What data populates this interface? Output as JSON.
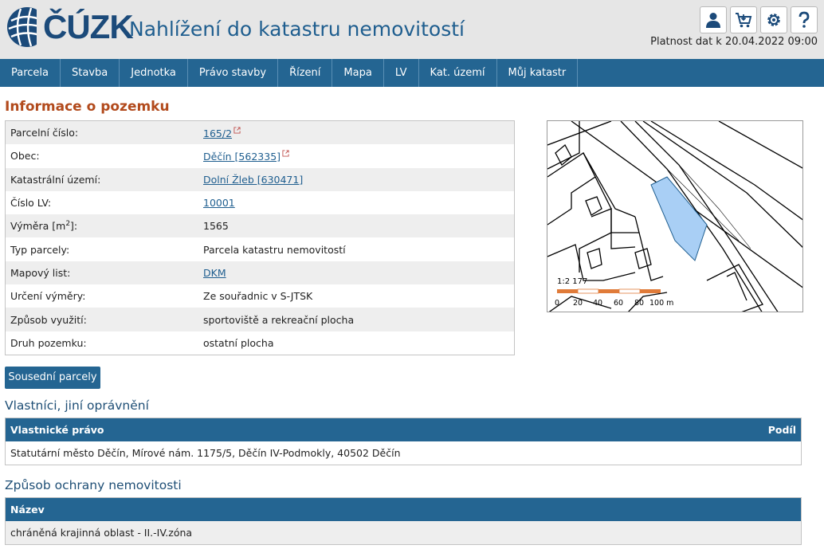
{
  "header": {
    "logo_text": "ČÚZK",
    "app_title": "Nahlížení do katastru nemovitostí",
    "validity": "Platnost dat k 20.04.2022 09:00",
    "icons": [
      "user-icon",
      "cart-icon",
      "settings-icon",
      "help-icon"
    ]
  },
  "nav": {
    "items": [
      "Parcela",
      "Stavba",
      "Jednotka",
      "Právo stavby",
      "Řízení",
      "Mapa",
      "LV",
      "Kat. území",
      "Můj katastr"
    ]
  },
  "info": {
    "title": "Informace o pozemku",
    "rows": [
      {
        "label": "Parcelní číslo:",
        "value": "165/2"
      },
      {
        "label": "Obec:",
        "value": "Děčín [562335]"
      },
      {
        "label": "Katastrální území:",
        "value": "Dolní Žleb [630471]"
      },
      {
        "label": "Číslo LV:",
        "value": "10001"
      },
      {
        "label": "Výměra [m",
        "label_sup": "2",
        "label_end": "]:",
        "value": "1565"
      },
      {
        "label": "Typ parcely:",
        "value": "Parcela katastru nemovitostí"
      },
      {
        "label": "Mapový list:",
        "value": "DKM"
      },
      {
        "label": "Určení výměry:",
        "value": "Ze souřadnic v S-JTSK"
      },
      {
        "label": "Způsob využití:",
        "value": "sportoviště a rekreační plocha"
      },
      {
        "label": "Druh pozemku:",
        "value": "ostatní plocha"
      }
    ]
  },
  "map": {
    "scale": "1:2 177",
    "scale_ticks": [
      "0",
      "20",
      "40",
      "60",
      "80",
      "100 m"
    ],
    "parcel_color": "#a9cff5"
  },
  "buttons": {
    "neighbors": "Sousední parcely"
  },
  "owners": {
    "title": "Vlastníci, jiní oprávnění",
    "header_left": "Vlastnické právo",
    "header_right": "Podíl",
    "rows": [
      "Statutární město Děčín, Mírové nám. 1175/5, Děčín IV-Podmokly, 40502 Děčín"
    ]
  },
  "protection": {
    "title": "Způsob ochrany nemovitosti",
    "header": "Název",
    "rows": [
      "chráněná krajinná oblast - II.-IV.zóna"
    ]
  },
  "colors": {
    "nav": "#246592",
    "section_title": "#b24a1c",
    "header_bg": "#e6e6e6"
  }
}
